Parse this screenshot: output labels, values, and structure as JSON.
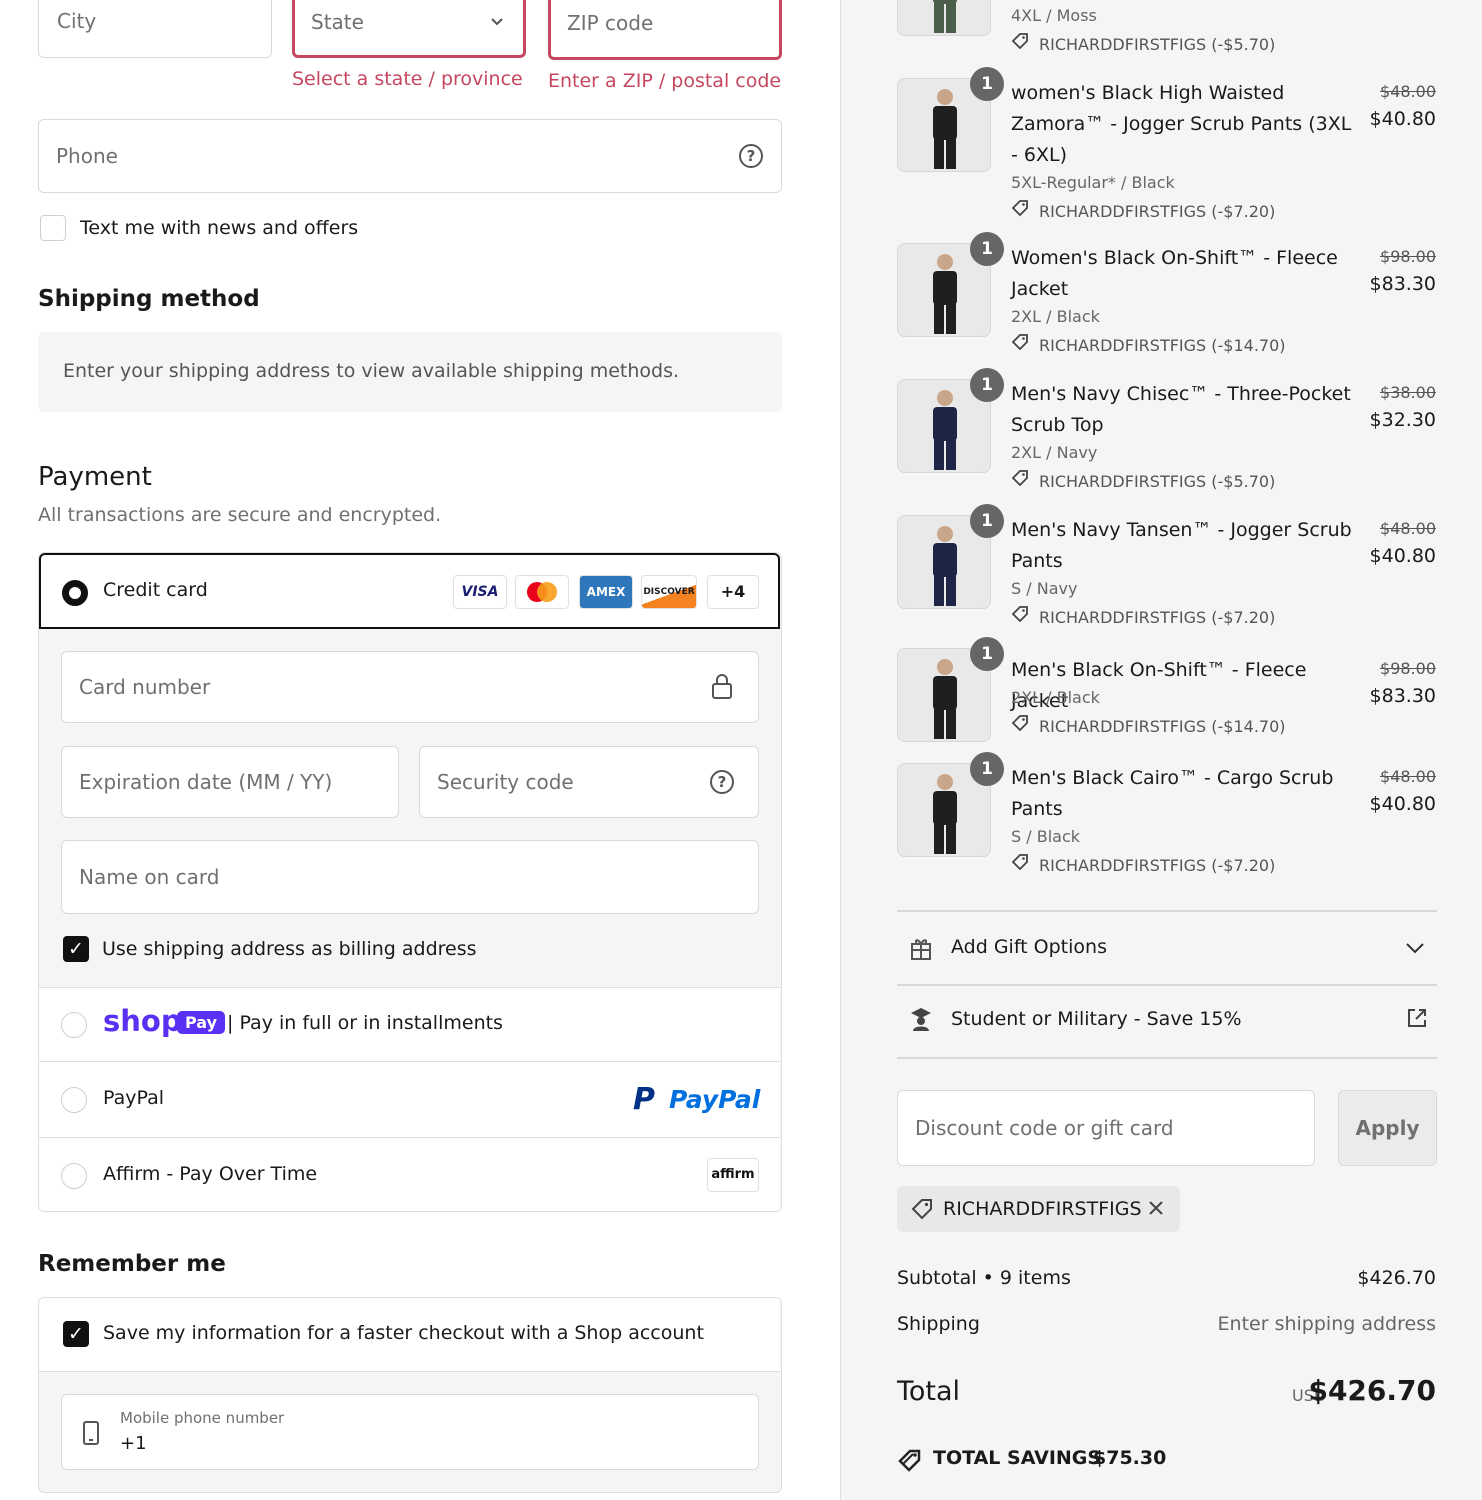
{
  "address": {
    "city_placeholder": "City",
    "state_placeholder": "State",
    "zip_placeholder": "ZIP code",
    "state_error": "Select a state / province",
    "zip_error": "Enter a ZIP / postal code",
    "phone_placeholder": "Phone",
    "sms_label": "Text me with news and offers"
  },
  "shipping": {
    "title": "Shipping method",
    "notice": "Enter your shipping address to view available shipping methods."
  },
  "payment": {
    "title": "Payment",
    "subtitle": "All transactions are secure and encrypted.",
    "credit_card_label": "Credit card",
    "card_brands": [
      "VISA",
      "MC",
      "AMEX",
      "DISCOVER"
    ],
    "more_brands": "+4",
    "card_number_placeholder": "Card number",
    "expiry_placeholder": "Expiration date (MM / YY)",
    "security_placeholder": "Security code",
    "name_placeholder": "Name on card",
    "billing_same_label": "Use shipping address as billing address",
    "shop_pay_logo": "shop",
    "shop_pay_badge": "Pay",
    "shop_pay_text": "| Pay in full or in installments",
    "paypal_label": "PayPal",
    "paypal_logo": "PayPal",
    "affirm_label": "Affirm - Pay Over Time",
    "affirm_logo": "affirm"
  },
  "remember": {
    "title": "Remember me",
    "save_label": "Save my information for a faster checkout with a Shop account",
    "mobile_label": "Mobile phone number",
    "mobile_prefix": "+1"
  },
  "cart": {
    "items": [
      {
        "name": "",
        "variant": "4XL / Moss",
        "discount": "RICHARDDFIRSTFIGS (-$5.70)",
        "old": "",
        "price": "",
        "qty": "",
        "color": "#4a5e4a"
      },
      {
        "name": "women's Black High Waisted Zamora™ - Jogger Scrub Pants (3XL - 6XL)",
        "variant": "5XL-Regular* / Black",
        "discount": "RICHARDDFIRSTFIGS (-$7.20)",
        "old": "$48.00",
        "price": "$40.80",
        "qty": "1",
        "color": "#1f1f1f"
      },
      {
        "name": "Women's Black On-Shift™ - Fleece Jacket",
        "variant": "2XL / Black",
        "discount": "RICHARDDFIRSTFIGS (-$14.70)",
        "old": "$98.00",
        "price": "$83.30",
        "qty": "1",
        "color": "#1f1f1f"
      },
      {
        "name": "Men's Navy Chisec™ - Three-Pocket Scrub Top",
        "variant": "2XL / Navy",
        "discount": "RICHARDDFIRSTFIGS (-$5.70)",
        "old": "$38.00",
        "price": "$32.30",
        "qty": "1",
        "color": "#1f2547"
      },
      {
        "name": "Men's Navy Tansen™ - Jogger Scrub Pants",
        "variant": "S / Navy",
        "discount": "RICHARDDFIRSTFIGS (-$7.20)",
        "old": "$48.00",
        "price": "$40.80",
        "qty": "1",
        "color": "#1f2547"
      },
      {
        "name": "Men's Black On-Shift™ - Fleece Jacket",
        "variant": "2XL / Black",
        "discount": "RICHARDDFIRSTFIGS (-$14.70)",
        "old": "$98.00",
        "price": "$83.30",
        "qty": "1",
        "color": "#1f1f1f"
      },
      {
        "name": "Men's Black Cairo™ - Cargo Scrub Pants",
        "variant": "S / Black",
        "discount": "RICHARDDFIRSTFIGS (-$7.20)",
        "old": "$48.00",
        "price": "$40.80",
        "qty": "1",
        "color": "#1f1f1f"
      }
    ],
    "gift_options": "Add Gift Options",
    "student": "Student or Military - Save 15%",
    "discount_placeholder": "Discount code or gift card",
    "apply_label": "Apply",
    "applied_code": "RICHARDDFIRSTFIGS",
    "subtotal_label": "Subtotal • 9 items",
    "subtotal_value": "$426.70",
    "shipping_label": "Shipping",
    "shipping_value": "Enter shipping address",
    "total_label": "Total",
    "currency": "USD",
    "total_value": "$426.70",
    "savings_label": "TOTAL SAVINGS",
    "savings_value": "$75.30"
  }
}
